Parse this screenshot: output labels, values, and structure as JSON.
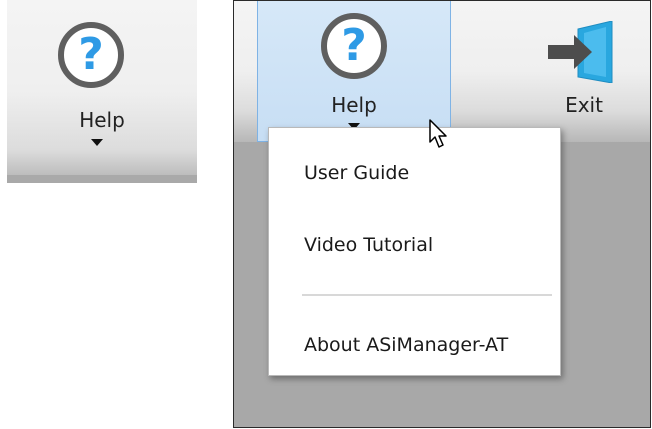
{
  "left_button": {
    "label": "Help",
    "icon": "help-circle-icon"
  },
  "toolbar": {
    "help_label": "Help",
    "exit_label": "Exit"
  },
  "help_menu": {
    "items": [
      {
        "label": "User Guide"
      },
      {
        "label": "Video Tutorial"
      },
      {
        "label": "About ASiManager-AT"
      }
    ]
  },
  "colors": {
    "accent_blue": "#2e9ae5",
    "active_button_bg": "#cfe3f6",
    "active_button_border": "#7fb3e5",
    "icon_ring": "#5f5f5f",
    "workspace_gray": "#a8a8a8"
  }
}
